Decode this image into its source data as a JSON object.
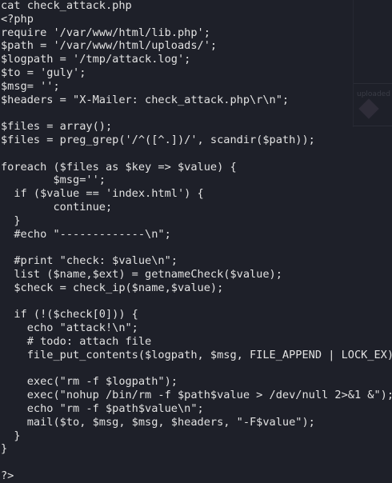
{
  "background_color": "#1e2029",
  "text_color": "#e2e2e2",
  "background_ghost": {
    "label": "uploaded",
    "icon": "file-icon"
  },
  "terminal": {
    "lines": [
      "cat check_attack.php",
      "<?php",
      "require '/var/www/html/lib.php';",
      "$path = '/var/www/html/uploads/';",
      "$logpath = '/tmp/attack.log';",
      "$to = 'guly';",
      "$msg= '';",
      "$headers = \"X-Mailer: check_attack.php\\r\\n\";",
      "",
      "$files = array();",
      "$files = preg_grep('/^([^.])/', scandir($path));",
      "",
      "foreach ($files as $key => $value) {",
      "        $msg='';",
      "  if ($value == 'index.html') {",
      "        continue;",
      "  }",
      "  #echo \"-------------\\n\";",
      "",
      "  #print \"check: $value\\n\";",
      "  list ($name,$ext) = getnameCheck($value);",
      "  $check = check_ip($name,$value);",
      "",
      "  if (!($check[0])) {",
      "    echo \"attack!\\n\";",
      "    # todo: attach file",
      "    file_put_contents($logpath, $msg, FILE_APPEND | LOCK_EX);",
      "",
      "    exec(\"rm -f $logpath\");",
      "    exec(\"nohup /bin/rm -f $path$value > /dev/null 2>&1 &\");",
      "    echo \"rm -f $path$value\\n\";",
      "    mail($to, $msg, $msg, $headers, \"-F$value\");",
      "  }",
      "}",
      "",
      "?>"
    ]
  }
}
